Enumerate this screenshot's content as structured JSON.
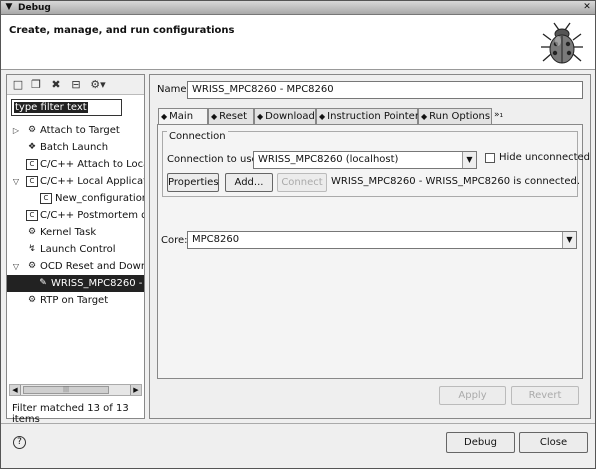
{
  "window": {
    "title": "Debug",
    "menu_glyph": "▼",
    "close_glyph": "✕"
  },
  "header": {
    "title": "Create, manage, and run configurations",
    "image_icon": "bug-icon"
  },
  "toolbar": {
    "icons": [
      "new-config-icon",
      "duplicate-icon",
      "delete-icon",
      "collapse-all-icon",
      "filter-icon"
    ]
  },
  "filter": {
    "value": "type filter text"
  },
  "tree": {
    "items": [
      {
        "label": "Attach to Target",
        "icon": "attach-icon",
        "expand": "▷",
        "glyph": "⚙"
      },
      {
        "label": "Batch Launch",
        "icon": "batch-icon",
        "glyph": "❖"
      },
      {
        "label": "C/C++ Attach to Local",
        "icon": "c-icon",
        "glyph": "C"
      },
      {
        "label": "C/C++ Local Applicatio",
        "icon": "c-icon",
        "expand": "▽",
        "glyph": "C"
      },
      {
        "label": "New_configuration",
        "icon": "c-icon",
        "glyph": "C"
      },
      {
        "label": "C/C++ Postmortem del",
        "icon": "c-icon",
        "glyph": "C"
      },
      {
        "label": "Kernel Task",
        "icon": "kernel-icon",
        "glyph": "⚙"
      },
      {
        "label": "Launch Control",
        "icon": "launch-icon",
        "glyph": "↯"
      },
      {
        "label": "OCD Reset and Downl",
        "icon": "ocd-icon",
        "expand": "▽",
        "glyph": "⚙"
      },
      {
        "label": "WRISS_MPC8260 -",
        "icon": "ocd-icon",
        "glyph": "✎",
        "selected": true
      },
      {
        "label": "RTP on Target",
        "icon": "rtp-icon",
        "glyph": "⚙"
      }
    ],
    "filter_status": "Filter matched 13 of 13 items"
  },
  "config": {
    "name_label": "Name:",
    "name_value": "WRISS_MPC8260 - MPC8260",
    "tabs": [
      {
        "label": "Main",
        "active": true
      },
      {
        "label": "Reset"
      },
      {
        "label": "Download"
      },
      {
        "label": "Instruction Pointer"
      },
      {
        "label": "Run Options"
      }
    ],
    "tabs_more": "»₁",
    "connection": {
      "group_title": "Connection",
      "label": "Connection to use:",
      "value": "WRISS_MPC8260 (localhost)",
      "hide_label": "Hide unconnected",
      "properties_label": "Properties",
      "add_label": "Add...",
      "connect_label": "Connect",
      "status": "WRISS_MPC8260 - WRISS_MPC8260 is connected."
    },
    "core": {
      "label": "Core:",
      "value": "MPC8260"
    },
    "apply_label": "Apply",
    "revert_label": "Revert"
  },
  "footer": {
    "help_glyph": "?",
    "debug_label": "Debug",
    "close_label": "Close"
  }
}
